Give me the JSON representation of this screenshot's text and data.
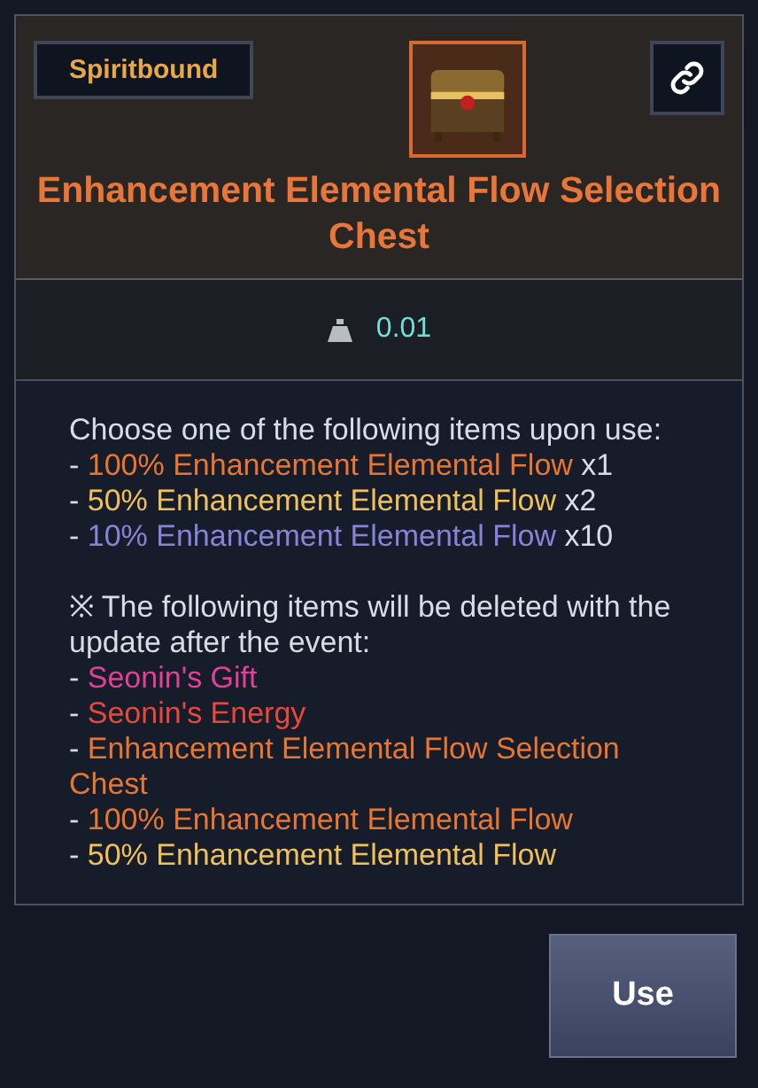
{
  "badge": "Spiritbound",
  "item": {
    "name": "Enhancement Elemental Flow Selection Chest",
    "weight": "0.01"
  },
  "description": [
    {
      "kind": "text",
      "text": "Choose one of the following items upon use:"
    },
    {
      "kind": "item",
      "prefix": "- ",
      "name": "100% Enhancement Elemental Flow",
      "suffix": " x1",
      "color": "#e8762e"
    },
    {
      "kind": "item",
      "prefix": "- ",
      "name": "50% Enhancement Elemental Flow",
      "suffix": " x2",
      "color": "#f0c05a"
    },
    {
      "kind": "item",
      "prefix": "- ",
      "name": "10% Enhancement Elemental Flow",
      "suffix": " x10",
      "color": "#8a82d8"
    },
    {
      "kind": "blank"
    },
    {
      "kind": "text",
      "text": "※ The following items will be deleted with the update after the event:"
    },
    {
      "kind": "item",
      "prefix": "- ",
      "name": "Seonin's Gift",
      "color": "#e0409a"
    },
    {
      "kind": "item",
      "prefix": "- ",
      "name": "Seonin's Energy",
      "color": "#e8483a"
    },
    {
      "kind": "item",
      "prefix": "- ",
      "name": "Enhancement Elemental Flow Selection Chest",
      "color": "#e8762e"
    },
    {
      "kind": "item",
      "prefix": "- ",
      "name": "100% Enhancement Elemental Flow",
      "color": "#e8762e"
    },
    {
      "kind": "item",
      "prefix": "- ",
      "name": "50% Enhancement Elemental Flow",
      "color": "#f0c05a"
    }
  ],
  "button": "Use"
}
